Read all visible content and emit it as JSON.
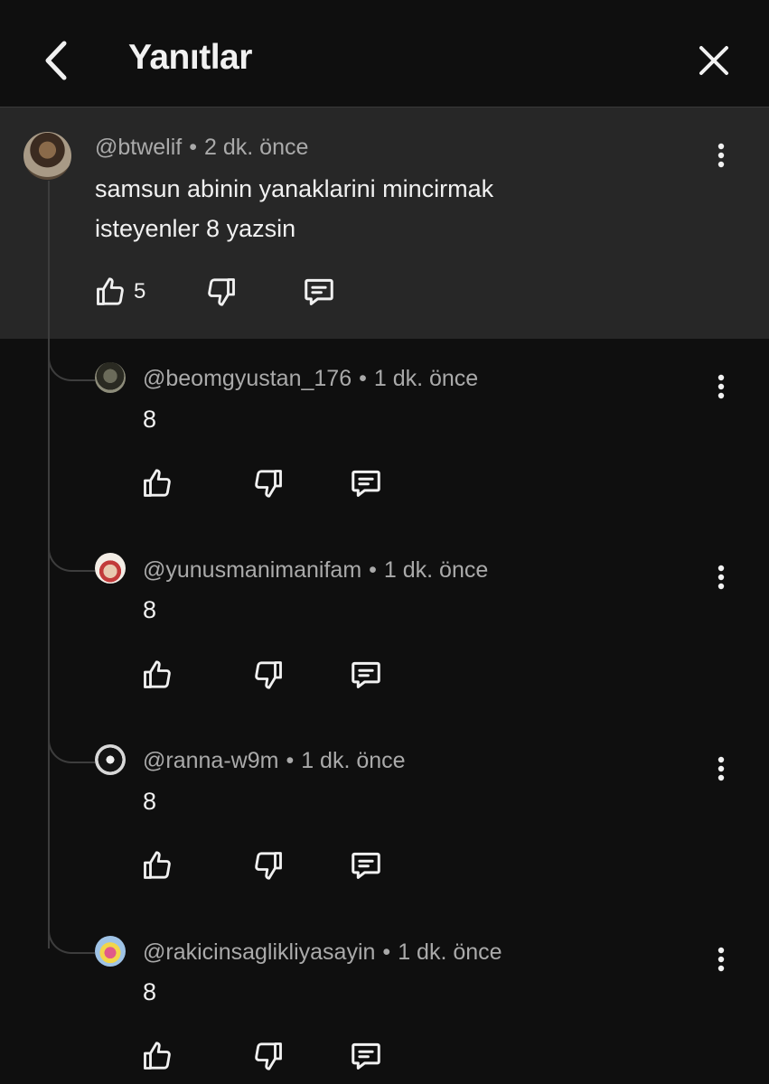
{
  "header": {
    "title": "Yanıtlar"
  },
  "parent": {
    "username": "@btwelif",
    "time": "2 dk. önce",
    "text_line1": "samsun abinin yanaklarini mincirmak",
    "text_line2": "isteyenler 8 yazsin",
    "like_count": "5"
  },
  "replies": [
    {
      "username": "@beomgyustan_176",
      "time": "1 dk. önce",
      "text": "8"
    },
    {
      "username": "@yunusmanimanifam",
      "time": "1 dk. önce",
      "text": "8"
    },
    {
      "username": "@ranna-w9m",
      "time": "1 dk. önce",
      "text": "8"
    },
    {
      "username": "@rakicinsaglikliyasayin",
      "time": "1 dk. önce",
      "text": "8"
    }
  ],
  "separator": "•"
}
